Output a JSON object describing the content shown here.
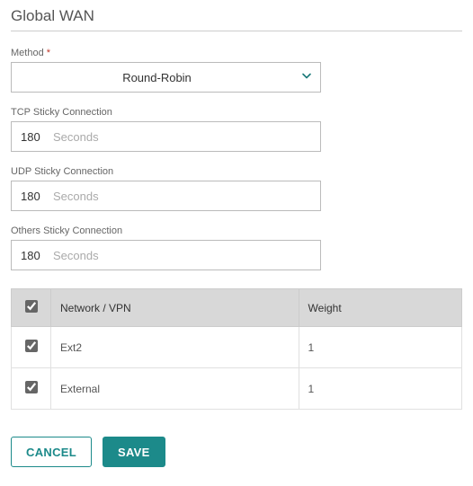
{
  "title": "Global WAN",
  "method": {
    "label": "Method",
    "required_marker": "*",
    "value": "Round-Robin"
  },
  "tcp": {
    "label": "TCP Sticky Connection",
    "value": "180",
    "unit": "Seconds"
  },
  "udp": {
    "label": "UDP Sticky Connection",
    "value": "180",
    "unit": "Seconds"
  },
  "others": {
    "label": "Others Sticky Connection",
    "value": "180",
    "unit": "Seconds"
  },
  "table": {
    "headers": {
      "network": "Network / VPN",
      "weight": "Weight"
    },
    "rows": [
      {
        "checked": true,
        "network": "Ext2",
        "weight": "1"
      },
      {
        "checked": true,
        "network": "External",
        "weight": "1"
      }
    ]
  },
  "buttons": {
    "cancel": "CANCEL",
    "save": "SAVE"
  }
}
